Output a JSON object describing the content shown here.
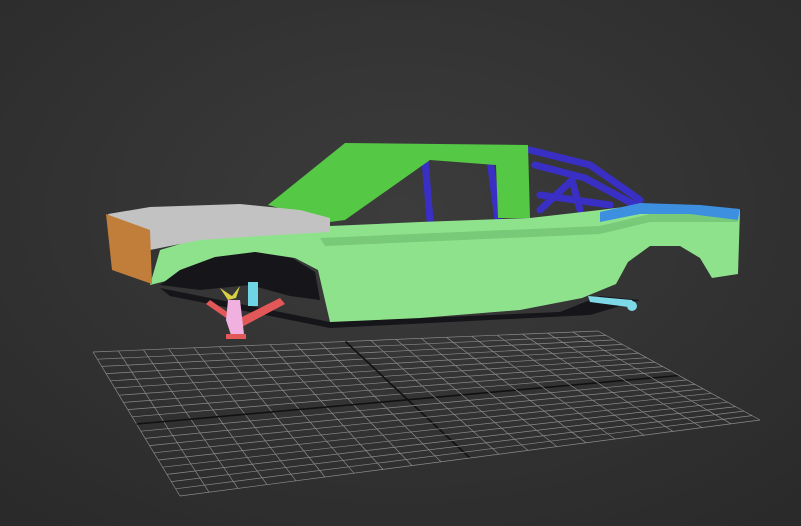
{
  "viewport": {
    "background_top": "#3c3c3c",
    "background_bottom": "#2a2a2a",
    "grid_color": "#8a8a8a",
    "grid_axis_color": "#111111"
  },
  "model": {
    "body_color": "#8fe28c",
    "body_shade_color": "#78c978",
    "cab_frame_color": "#55c845",
    "roll_cage_color": "#3a2fc4",
    "hood_color": "#c2c2c2",
    "front_bumper_color": "#c07e3a",
    "rear_fender_color": "#3d8fe0",
    "suspension_colors": {
      "arm_red": "#e25858",
      "upright_pink": "#f0b0e0",
      "spring_cyan": "#6fd4e4",
      "shock_yellow": "#d6d042",
      "rear_arm_cyan": "#7dd8e8"
    }
  }
}
